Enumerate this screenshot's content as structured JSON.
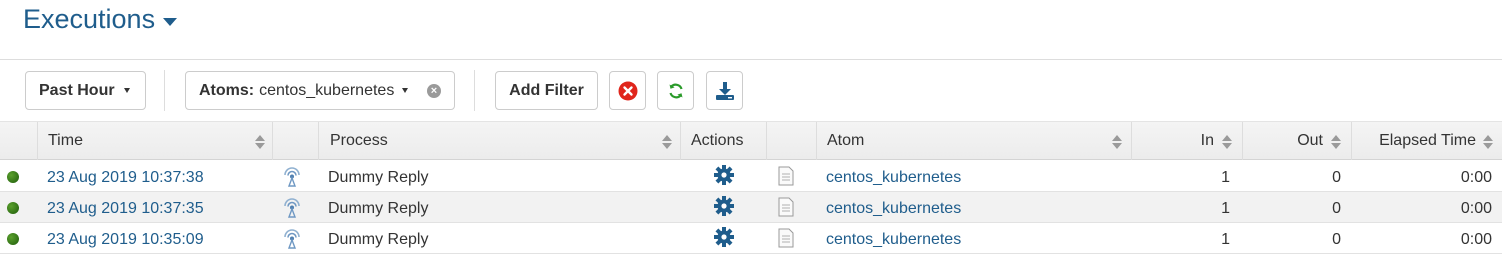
{
  "header": {
    "title": "Executions"
  },
  "toolbar": {
    "time_range": "Past Hour",
    "filter_label": "Atoms:",
    "filter_value": "centos_kubernetes",
    "add_filter": "Add Filter"
  },
  "colors": {
    "title": "#1f5d8c",
    "link": "#1f5d8c",
    "status_ok": "#3a8a1a",
    "clear_red": "#e0261c",
    "refresh_green": "#2a9a2a",
    "download_blue": "#1f5d8c"
  },
  "table": {
    "headers": {
      "time": "Time",
      "process": "Process",
      "actions": "Actions",
      "atom": "Atom",
      "in": "In",
      "out": "Out",
      "elapsed": "Elapsed Time"
    },
    "rows": [
      {
        "status": "success",
        "time": "23 Aug 2019 10:37:38",
        "process": "Dummy Reply",
        "atom": "centos_kubernetes",
        "in": "1",
        "out": "0",
        "elapsed": "0:00"
      },
      {
        "status": "success",
        "time": "23 Aug 2019 10:37:35",
        "process": "Dummy Reply",
        "atom": "centos_kubernetes",
        "in": "1",
        "out": "0",
        "elapsed": "0:00"
      },
      {
        "status": "success",
        "time": "23 Aug 2019 10:35:09",
        "process": "Dummy Reply",
        "atom": "centos_kubernetes",
        "in": "1",
        "out": "0",
        "elapsed": "0:00"
      }
    ]
  }
}
